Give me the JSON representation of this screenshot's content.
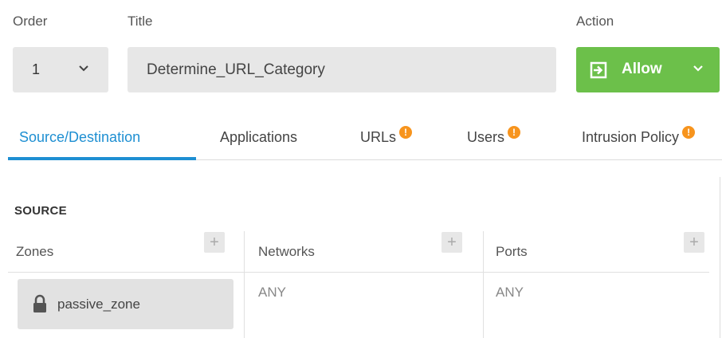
{
  "header": {
    "order_label": "Order",
    "title_label": "Title",
    "action_label": "Action"
  },
  "order": {
    "value": "1"
  },
  "title": {
    "value": "Determine_URL_Category"
  },
  "action": {
    "label": "Allow",
    "color": "#6cc04a"
  },
  "tabs": [
    {
      "label": "Source/Destination",
      "active": true,
      "warning": false
    },
    {
      "label": "Applications",
      "active": false,
      "warning": false
    },
    {
      "label": "URLs",
      "active": false,
      "warning": true
    },
    {
      "label": "Users",
      "active": false,
      "warning": true
    },
    {
      "label": "Intrusion Policy",
      "active": false,
      "warning": true
    }
  ],
  "warning_glyph": "!",
  "source": {
    "section_title": "SOURCE",
    "columns": [
      {
        "label": "Zones",
        "plus": "+"
      },
      {
        "label": "Networks",
        "plus": "+"
      },
      {
        "label": "Ports",
        "plus": "+"
      }
    ],
    "zones": [
      {
        "name": "passive_zone",
        "icon": "lock-icon"
      }
    ],
    "networks_value": "ANY",
    "ports_value": "ANY"
  },
  "colors": {
    "accent": "#1e8fd2",
    "warning": "#f7941d",
    "allow": "#6cc04a"
  }
}
